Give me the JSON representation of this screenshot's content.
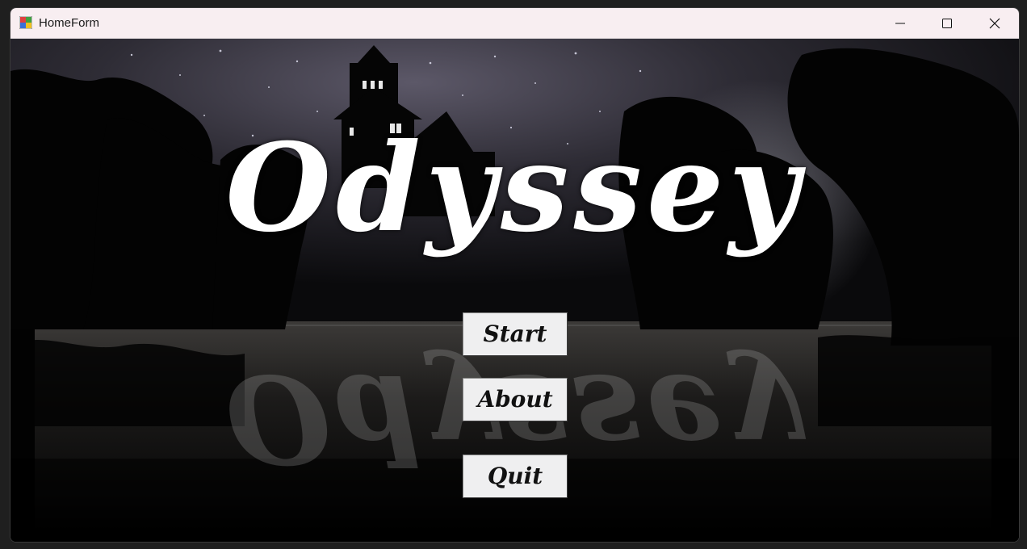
{
  "window": {
    "title": "HomeForm",
    "controls": {
      "minimize_icon": "minimize-icon",
      "maximize_icon": "maximize-icon",
      "close_icon": "close-icon"
    }
  },
  "game": {
    "logo_text": "Odyssey",
    "menu": {
      "start_label": "Start",
      "about_label": "About",
      "quit_label": "Quit"
    }
  },
  "colors": {
    "titlebar_bg": "#f8eef1",
    "button_bg": "#efeff0",
    "logo": "#ffffff"
  }
}
